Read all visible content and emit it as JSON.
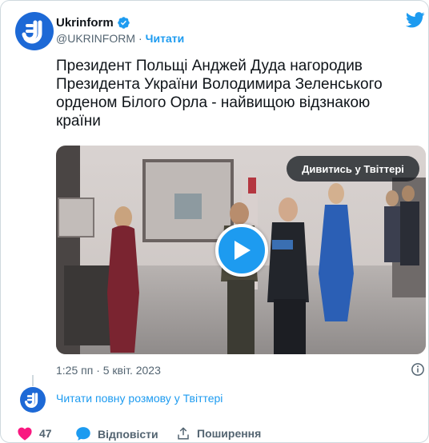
{
  "author": {
    "name": "Ukrinform",
    "handle": "@UKRINFORM",
    "separator": "·",
    "follow_label": "Читати"
  },
  "tweet": {
    "text": "Президент Польщі Анджей Дуда нагородив Президента України Володимира Зеленського орденом Білого Орла - найвищою відзнакою країни",
    "timestamp": "1:25 пп · 5 квіт. 2023"
  },
  "media": {
    "watch_label": "Дивитись у Твіттері"
  },
  "thread": {
    "read_full_label": "Читати повну розмову у Твіттері"
  },
  "actions": {
    "like_count": "47",
    "reply_label": "Відповісти",
    "share_label": "Поширення"
  },
  "colors": {
    "accent": "#1d9bf0",
    "brand": "#1d69d6",
    "like": "#f91880",
    "muted": "#536471"
  },
  "icons": [
    "verified-badge-icon",
    "twitter-bird-icon",
    "play-icon",
    "info-icon",
    "heart-icon",
    "reply-bubble-icon",
    "share-icon",
    "ukrinform-logo"
  ]
}
